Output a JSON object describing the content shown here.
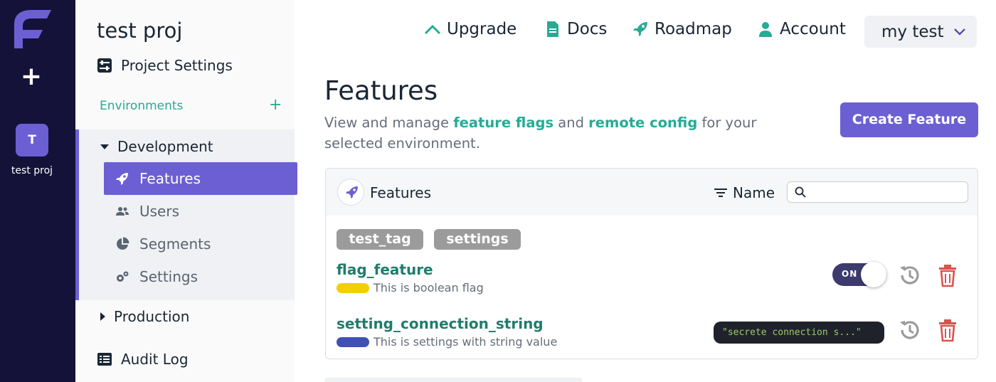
{
  "rail": {
    "project_initial": "T",
    "project_label": "test proj"
  },
  "sidebar": {
    "project_name": "test proj",
    "project_settings": "Project Settings",
    "environments_label": "Environments",
    "environments": [
      {
        "name": "Development",
        "expanded": true,
        "items": [
          {
            "label": "Features",
            "icon": "rocket-icon",
            "active": true
          },
          {
            "label": "Users",
            "icon": "users-icon",
            "active": false
          },
          {
            "label": "Segments",
            "icon": "pie-chart-icon",
            "active": false
          },
          {
            "label": "Settings",
            "icon": "cogs-icon",
            "active": false
          }
        ]
      },
      {
        "name": "Production",
        "expanded": false
      }
    ],
    "audit_log": "Audit Log"
  },
  "topnav": {
    "upgrade": "Upgrade",
    "docs": "Docs",
    "roadmap": "Roadmap",
    "account": "Account",
    "organisation": "my test"
  },
  "main": {
    "title": "Features",
    "desc_prefix": "View and manage ",
    "desc_link1": "feature flags",
    "desc_mid": " and ",
    "desc_link2": "remote config",
    "desc_suffix": " for your selected environment.",
    "create_button": "Create Feature",
    "panel": {
      "title": "Features",
      "sort_label": "Name",
      "search_placeholder": "",
      "tags": [
        "test_tag",
        "settings"
      ],
      "features": [
        {
          "name": "flag_feature",
          "description": "This is boolean flag",
          "tag_color": "#f2d000",
          "type": "toggle",
          "toggle_label": "ON",
          "enabled": true
        },
        {
          "name": "setting_connection_string",
          "description": "This is settings with string value",
          "tag_color": "#3f51b5",
          "type": "value",
          "value": "\"secrete connection s...\""
        }
      ]
    }
  },
  "colors": {
    "brand": "#6c5fd4",
    "rail": "#15123a",
    "link": "#27ab95",
    "danger": "#d9534f"
  }
}
